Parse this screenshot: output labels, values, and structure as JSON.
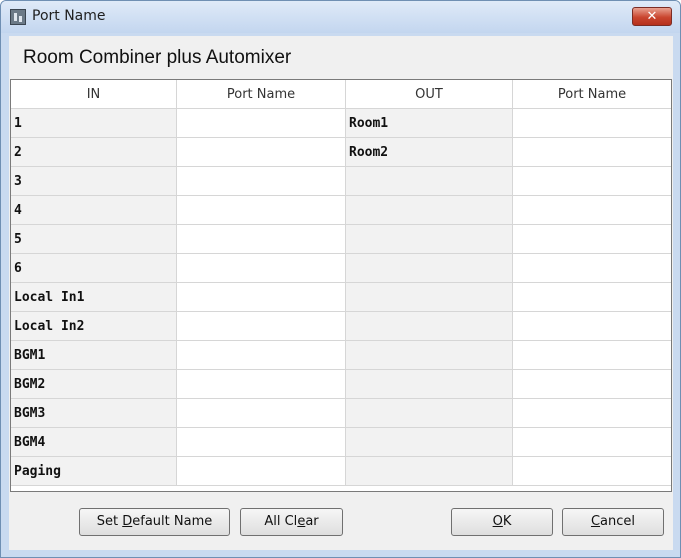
{
  "window": {
    "title": "Port Name",
    "close_label": "✕"
  },
  "dialog": {
    "heading": "Room Combiner plus Automixer"
  },
  "table": {
    "headers": [
      "IN",
      "Port Name",
      "OUT",
      "Port Name"
    ],
    "rows": [
      {
        "in": "1",
        "in_name": "",
        "out": "Room1",
        "out_name": ""
      },
      {
        "in": "2",
        "in_name": "",
        "out": "Room2",
        "out_name": ""
      },
      {
        "in": "3",
        "in_name": "",
        "out": "",
        "out_name": ""
      },
      {
        "in": "4",
        "in_name": "",
        "out": "",
        "out_name": ""
      },
      {
        "in": "5",
        "in_name": "",
        "out": "",
        "out_name": ""
      },
      {
        "in": "6",
        "in_name": "",
        "out": "",
        "out_name": ""
      },
      {
        "in": "Local In1",
        "in_name": "",
        "out": "",
        "out_name": ""
      },
      {
        "in": "Local In2",
        "in_name": "",
        "out": "",
        "out_name": ""
      },
      {
        "in": "BGM1",
        "in_name": "",
        "out": "",
        "out_name": ""
      },
      {
        "in": "BGM2",
        "in_name": "",
        "out": "",
        "out_name": ""
      },
      {
        "in": "BGM3",
        "in_name": "",
        "out": "",
        "out_name": ""
      },
      {
        "in": "BGM4",
        "in_name": "",
        "out": "",
        "out_name": ""
      },
      {
        "in": "Paging",
        "in_name": "",
        "out": "",
        "out_name": ""
      }
    ]
  },
  "buttons": {
    "set_default": {
      "pre": "Set ",
      "mnemonic": "D",
      "post": "efault Name"
    },
    "all_clear": {
      "pre": "All Cl",
      "mnemonic": "e",
      "post": "ar"
    },
    "ok": {
      "pre": "",
      "mnemonic": "O",
      "post": "K"
    },
    "cancel": {
      "pre": "",
      "mnemonic": "C",
      "post": "ancel"
    }
  }
}
